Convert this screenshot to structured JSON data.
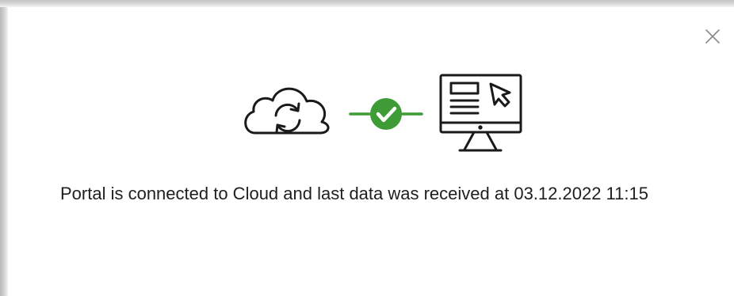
{
  "dialog": {
    "close_icon": "close-icon",
    "illustration": {
      "left_icon": "cloud-sync-icon",
      "status_icon": "check-circle-icon",
      "right_icon": "monitor-icon",
      "status_color": "#3f9b35",
      "line_color": "#1a1a1a"
    },
    "message": "Portal is connected to Cloud and last data was received at 03.12.2022 11:15"
  }
}
